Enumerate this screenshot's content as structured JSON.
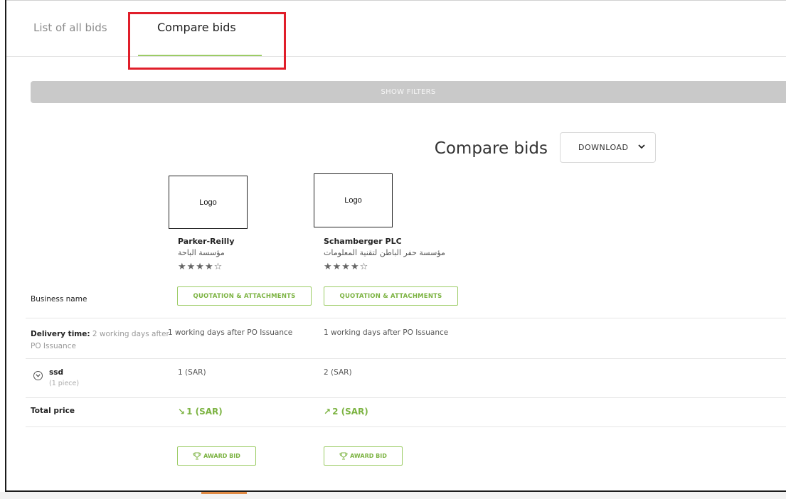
{
  "tabs": [
    {
      "label": "List of all bids",
      "active": false
    },
    {
      "label": "Compare bids",
      "active": true
    }
  ],
  "filters": {
    "label": "SHOW FILTERS"
  },
  "header": {
    "title": "Compare bids",
    "download_label": "DOWNLOAD"
  },
  "vendors": [
    {
      "logo_text": "Logo",
      "name": "Parker-Reilly",
      "name_ar": "مؤسسة الباحة",
      "rating_stars": "★★★★☆",
      "rating": 4,
      "quotation_label": "QUOTATION & ATTACHMENTS",
      "delivery": "1 working days after PO Issuance",
      "item_price": "1 (SAR)",
      "total_arrow": "↘",
      "total": "1 (SAR)",
      "award_label": "AWARD BID"
    },
    {
      "logo_text": "Logo",
      "name": "Schamberger PLC",
      "name_ar": "مؤسسة حفر الباطن لتقنية المعلومات",
      "rating_stars": "★★★★☆",
      "rating": 4,
      "quotation_label": "QUOTATION & ATTACHMENTS",
      "delivery": "1 working days after PO Issuance",
      "item_price": "2 (SAR)",
      "total_arrow": "↗",
      "total": "2 (SAR)",
      "award_label": "AWARD BID"
    }
  ],
  "rows": {
    "business_name": "Business name",
    "delivery_label": "Delivery time:",
    "delivery_requested_line1": "2 working days after",
    "delivery_requested_line2": "PO Issuance",
    "item_name": "ssd",
    "item_qty": "(1 piece)",
    "total_price": "Total price"
  },
  "colors": {
    "accent_green": "#7cb342",
    "highlight_red": "#e01e2a",
    "filter_bar": "#c9c9c9"
  },
  "icons": {
    "download_chevron": "chevron-down-icon",
    "item_toggle": "circle-chevron-down-icon",
    "award": "trophy-icon"
  }
}
